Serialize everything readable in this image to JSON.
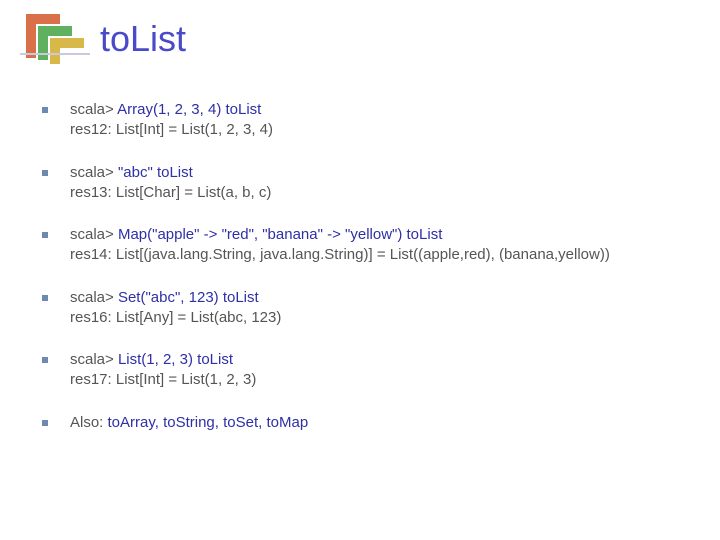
{
  "title": "toList",
  "bullets": [
    {
      "prompt": "scala>",
      "code": " Array(1, 2, 3, 4) toList",
      "output": "res12: List[Int] = List(1, 2, 3, 4)"
    },
    {
      "prompt": "scala> ",
      "code": "\"abc\" toList",
      "output": "res13: List[Char] = List(a, b, c)"
    },
    {
      "prompt": "scala>",
      "code": " Map(\"apple\" -> \"red\", \"banana\" -> \"yellow\") toList",
      "output": "res14: List[(java.lang.String, java.lang.String)] = List((apple,red), (banana,yellow))"
    },
    {
      "prompt": "scala> ",
      "code": "Set(\"abc\", 123) toList",
      "output": "res16: List[Any] = List(abc, 123)"
    },
    {
      "prompt": "scala>",
      "code": " List(1, 2, 3) toList",
      "output": "res17: List[Int] = List(1, 2, 3)"
    }
  ],
  "also": {
    "label": "Also: ",
    "methods": "toArray, toString, toSet, toMap"
  }
}
